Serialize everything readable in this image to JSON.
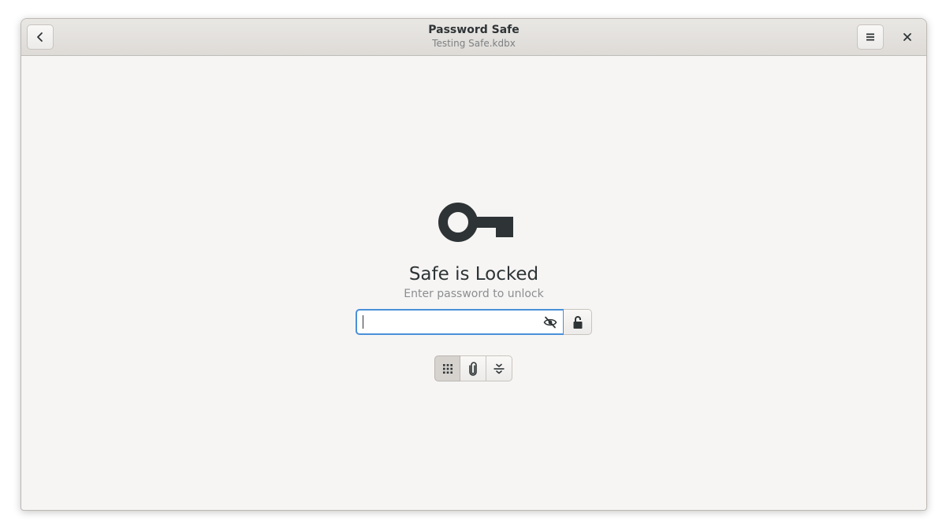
{
  "window": {
    "title": "Password Safe",
    "subtitle": "Testing Safe.kdbx"
  },
  "header": {
    "back_icon": "chevron-left-icon",
    "menu_icon": "hamburger-menu-icon",
    "close_icon": "close-icon"
  },
  "lock_screen": {
    "icon": "key-icon",
    "title": "Safe is Locked",
    "subtitle": "Enter password to unlock",
    "password_field": {
      "value": "",
      "placeholder": "",
      "reveal_icon": "eye-hidden-icon"
    },
    "unlock_icon": "unlocked-padlock-icon",
    "modes": [
      {
        "icon": "keypad-icon",
        "active": true
      },
      {
        "icon": "paperclip-icon",
        "active": false
      },
      {
        "icon": "composite-icon",
        "active": false
      }
    ]
  },
  "colors": {
    "accent": "#4a90d9",
    "background": "#f6f5f4",
    "text": "#2e3436"
  }
}
